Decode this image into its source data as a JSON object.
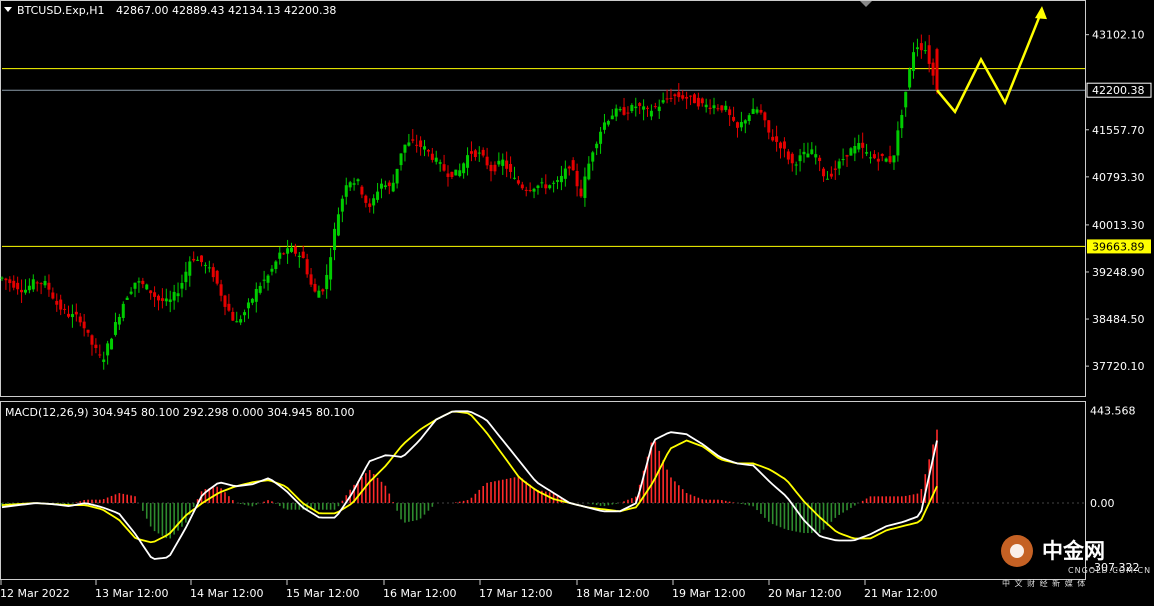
{
  "chart_data": [
    {
      "type": "candlestick",
      "panel": "price",
      "title": "BTCUSD.Exp,H1",
      "ohlc_label": "42867.00 42889.43 42134.13 42200.38",
      "symbol": "BTCUSD.Exp",
      "timeframe": "H1",
      "open": 42867.0,
      "high": 42889.43,
      "low": 42134.13,
      "close": 42200.38,
      "ylim": [
        37300,
        43600
      ],
      "y_ticks": [
        "43102.10",
        "41557.70",
        "40793.30",
        "40013.30",
        "39248.90",
        "38484.50",
        "37720.10"
      ],
      "y_tick_values": [
        43102.1,
        41557.7,
        40793.3,
        40013.3,
        39248.9,
        38484.5,
        37720.1
      ],
      "x_ticks": [
        "12 Mar 2022",
        "13 Mar 12:00",
        "14 Mar 12:00",
        "15 Mar 12:00",
        "16 Mar 12:00",
        "17 Mar 12:00",
        "18 Mar 12:00",
        "19 Mar 12:00",
        "20 Mar 12:00",
        "21 Mar 12:00"
      ],
      "current_price_label": "42200.38",
      "current_price": 42200.38,
      "horizontal_levels": [
        {
          "value": 42550,
          "label": "",
          "color": "#ffff00"
        },
        {
          "value": 39663.89,
          "label": "39663.89",
          "color": "#ffff00"
        }
      ],
      "price_path": [
        39150,
        39050,
        38950,
        39100,
        39050,
        38700,
        38550,
        38500,
        38100,
        37800,
        38300,
        38800,
        39100,
        39000,
        38800,
        38750,
        39000,
        39500,
        39400,
        39200,
        38750,
        38400,
        38650,
        39000,
        39200,
        39550,
        39600,
        39500,
        38900,
        39000,
        40050,
        40750,
        40700,
        40250,
        40700,
        40600,
        41300,
        41350,
        41250,
        41050,
        40850,
        40850,
        41200,
        41150,
        40900,
        41050,
        40750,
        40600,
        40650,
        40650,
        40700,
        41000,
        40500,
        41200,
        41650,
        41850,
        41850,
        41950,
        41850,
        41950,
        42100,
        42100,
        42050,
        41950,
        41950,
        41900,
        41550,
        41800,
        41900,
        41450,
        41300,
        41000,
        41150,
        41200,
        40750,
        40950,
        41200,
        41300,
        41100,
        41100,
        41050,
        42000,
        42950,
        42860,
        42200
      ],
      "projection_arrow": {
        "color": "#ffff00",
        "path": [
          42200,
          41850,
          42700,
          42000,
          43500
        ]
      },
      "grid": false,
      "background": "#000000",
      "bull_color": "#00cc00",
      "bear_color": "#e60000"
    },
    {
      "type": "macd",
      "panel": "indicator",
      "title": "MACD(12,26,9) 304.945 80.100 292.298 0.000 304.945 80.100",
      "params": "12,26,9",
      "values_label": "304.945 80.100 292.298 0.000 304.945 80.100",
      "ylim": [
        -350,
        470
      ],
      "y_ticks": [
        "443.568",
        "0.00",
        "-307.322"
      ],
      "y_tick_values": [
        443.568,
        0.0,
        -307.322
      ],
      "macd_color": "#ffffff",
      "signal_color": "#ffff00",
      "histogram_positive_color": "#ff2a2a",
      "histogram_negative_color": "#2e8b2e",
      "macd_line": [
        -20,
        -10,
        0,
        -5,
        -15,
        0,
        -20,
        -50,
        -150,
        -270,
        -260,
        -120,
        40,
        100,
        80,
        90,
        120,
        60,
        -20,
        -70,
        -70,
        50,
        200,
        230,
        220,
        300,
        400,
        440,
        440,
        400,
        300,
        200,
        100,
        50,
        0,
        -20,
        -40,
        -40,
        0,
        300,
        340,
        330,
        280,
        220,
        190,
        180,
        100,
        30,
        -80,
        -160,
        -180,
        -180,
        -150,
        -110,
        -90,
        -60,
        300
      ],
      "signal_line": [
        -10,
        -5,
        0,
        -5,
        -10,
        -10,
        -30,
        -80,
        -170,
        -190,
        -150,
        -60,
        0,
        50,
        80,
        100,
        110,
        80,
        0,
        -50,
        -50,
        0,
        100,
        180,
        280,
        350,
        400,
        440,
        430,
        340,
        230,
        120,
        60,
        20,
        0,
        -20,
        -30,
        -40,
        -20,
        100,
        260,
        300,
        270,
        210,
        190,
        190,
        160,
        110,
        10,
        -70,
        -140,
        -170,
        -170,
        -130,
        -110,
        -90,
        80
      ]
    }
  ],
  "watermark": {
    "text": "中金网",
    "subtext": "中 文 财 经 新 媒 体",
    "url_text": "CNGOLD.COM.CN",
    "icon": "cngold-logo-icon"
  }
}
